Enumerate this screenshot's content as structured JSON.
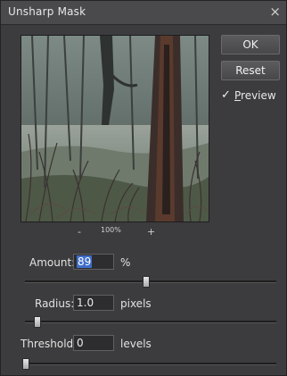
{
  "window": {
    "title": "Unsharp Mask",
    "close_glyph": "×",
    "close_icon": "close-icon"
  },
  "preview": {
    "zoom_out_glyph": "-",
    "zoom_in_glyph": "+",
    "zoom_level": "100%"
  },
  "buttons": {
    "ok_label": "OK",
    "reset_label": "Reset"
  },
  "preview_toggle": {
    "checked": true,
    "check_glyph": "✓",
    "label_mnemonic": "P",
    "label_rest": "review"
  },
  "amount": {
    "label": "Amount:",
    "value": "89",
    "unit": "%",
    "slider_fraction": 0.48
  },
  "radius": {
    "label": "Radius:",
    "value": "1.0",
    "unit": "pixels",
    "slider_fraction": 0.045
  },
  "threshold": {
    "label": "Threshold:",
    "value": "0",
    "unit": "levels",
    "slider_fraction": 0.0
  },
  "colors": {
    "dialog_bg": "#3c3c3e",
    "selection": "#3f6ec9"
  }
}
